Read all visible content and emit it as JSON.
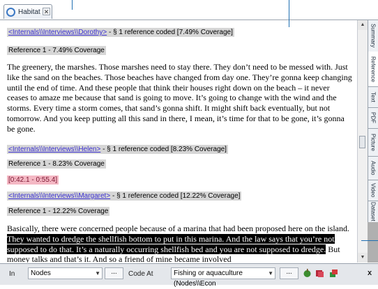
{
  "tab": {
    "title": "Habitat",
    "close": "✕"
  },
  "documents": [
    {
      "source": "<Internals\\\\Interviews\\\\Dorothy>",
      "summary": "- § 1 reference coded  [7.49% Coverage]",
      "reference": "Reference 1 - 7.49% Coverage",
      "text": "The greenery, the marshes. Those marshes need to stay there. They don’t need to be messed with. Just like the sand on the beaches. Those beaches have changed from day one. They’re gonna keep changing until the end of time. And these people that think their houses right down on the beach – it never ceases to amaze me because that sand is going to move. It’s going to change with the wind and the storms. Every time a storm comes, that sand’s gonna shift. It might shift back eventually, but not tomorrow. And you keep putting all this sand in there, I mean, it’s time for that to be gone, it’s gonna be gone."
    },
    {
      "source": "<Internals\\\\Interviews\\\\Helen>",
      "summary": "- § 1 reference coded  [8.23% Coverage]",
      "reference": "Reference 1 - 8.23% Coverage",
      "media_range": "[0:42.1 - 0:55.4]"
    },
    {
      "source": "<Internals\\\\Interviews\\\\Margaret>",
      "summary": "- § 1 reference coded  [12.22% Coverage]",
      "reference": "Reference 1 - 12.22% Coverage",
      "text_before": "Basically, there were concerned people because of a marina that had been proposed here on the island. ",
      "text_highlighted": "They wanted to dredge the shellfish bottom to put in this marina. And the law says that you’re not supposed to do that. It’s a naturally occurring shellfish bed and you are not supposed to dredge.",
      "text_after": " But money talks and that’s it. And so a friend of mine became involved"
    }
  ],
  "side_tabs": [
    "Summary",
    "Reference",
    "Text",
    "PDF",
    "Picture",
    "Audio",
    "Video",
    "Dataset"
  ],
  "active_side_tab": "Reference",
  "toolbar": {
    "in_label": "In",
    "in_value": "Nodes",
    "dots": "...",
    "code_at_label": "Code At",
    "code_at_value": "Fishing or aquaculture (Nodes\\\\Econ",
    "close": "x"
  },
  "colors": {
    "accent": "#3a2fd1",
    "highlight": "#000000",
    "media_mark": "#f4b8c4",
    "header_bg": "#d6d6d6"
  }
}
